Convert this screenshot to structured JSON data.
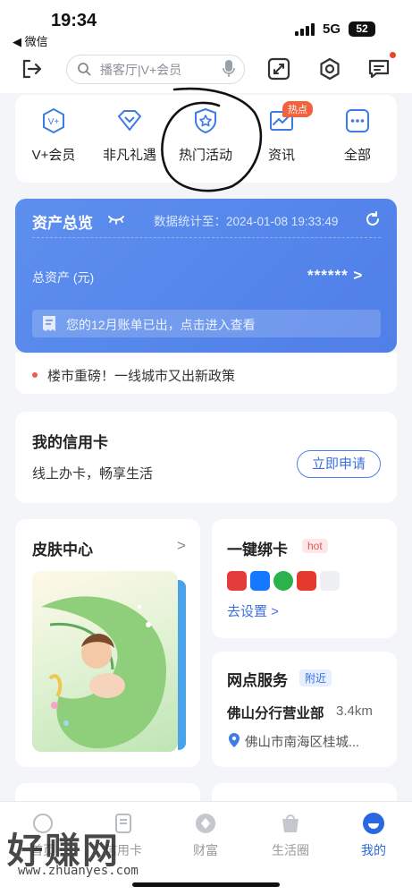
{
  "status_bar": {
    "time": "19:34",
    "back_app": "◀ 微信",
    "network": "5G",
    "battery": "52"
  },
  "header": {
    "search_placeholder": "播客厅|V+会员",
    "icons": [
      "logout-icon",
      "search-icon",
      "microphone-icon",
      "scan-icon",
      "settings-icon",
      "message-icon"
    ]
  },
  "quick_menu": [
    {
      "label": "V+会员",
      "icon": "vplus-icon"
    },
    {
      "label": "非凡礼遇",
      "icon": "diamond-heart-icon"
    },
    {
      "label": "热门活动",
      "icon": "star-shield-icon"
    },
    {
      "label": "资讯",
      "icon": "news-icon",
      "tag": "热点"
    },
    {
      "label": "全部",
      "icon": "more-grid-icon"
    }
  ],
  "assets": {
    "title": "资产总览",
    "stat_time": "数据统计至：2024-01-08 19:33:49",
    "total_label": "总资产 (元)",
    "total_value": "****** >",
    "bill_notice": "您的12月账单已出，点击进入查看"
  },
  "news": {
    "text": "楼市重磅！一线城市又出新政策"
  },
  "credit": {
    "title": "我的信用卡",
    "subtitle": "线上办卡，畅享生活",
    "button": "立即申请"
  },
  "skin": {
    "title": "皮肤中心",
    "arrow": ">"
  },
  "bind": {
    "title": "一键绑卡",
    "tag": "hot",
    "link": "去设置 >"
  },
  "branch": {
    "title": "网点服务",
    "tag": "附近",
    "name": "佛山分行营业部",
    "distance": "3.4km",
    "address": "佛山市南海区桂城..."
  },
  "tabs": [
    {
      "label": "首页",
      "active": false
    },
    {
      "label": "信用卡",
      "active": false
    },
    {
      "label": "财富",
      "active": false
    },
    {
      "label": "生活圈",
      "active": false
    },
    {
      "label": "我的",
      "active": true
    }
  ],
  "watermark": {
    "brand": "好赚网",
    "url": "www.zhuanyes.com"
  },
  "colors": {
    "accent": "#2a67e0",
    "asset_card": "#5a8bec",
    "hot": "#f4623d"
  }
}
